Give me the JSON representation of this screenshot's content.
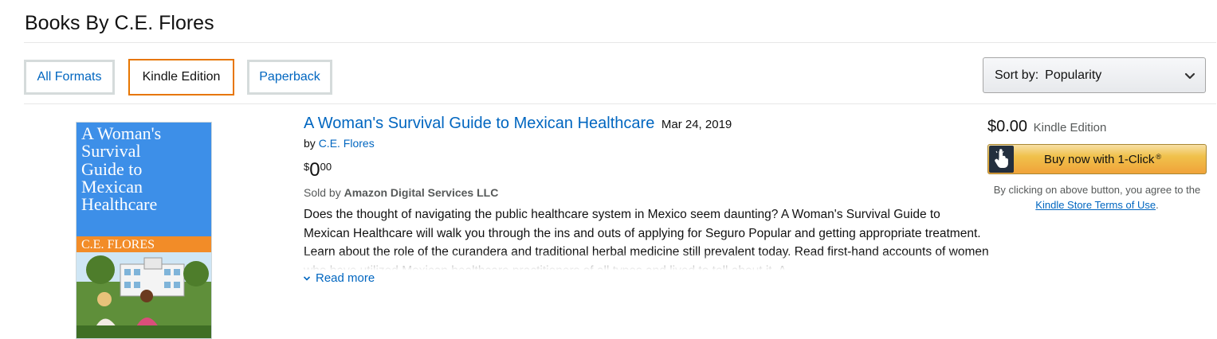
{
  "page": {
    "title": "Books By C.E. Flores"
  },
  "filters": {
    "formats": [
      {
        "label": "All Formats"
      },
      {
        "label": "Kindle Edition",
        "selected": true
      },
      {
        "label": "Paperback"
      }
    ]
  },
  "sort": {
    "label": "Sort by:",
    "value": "Popularity"
  },
  "book": {
    "cover": {
      "title_text": "A Woman's Survival Guide to Mexican Healthcare",
      "author_text": "C.E. FLORES",
      "colors": {
        "sky": "#3d8fe8",
        "band": "#f28c28"
      }
    },
    "title": "A Woman's Survival Guide to Mexican Healthcare",
    "date": "Mar 24, 2019",
    "by_label": "by",
    "author": "C.E. Flores",
    "price": {
      "symbol": "$",
      "whole": "0",
      "fraction": "00"
    },
    "sold_by_label": "Sold by",
    "seller": "Amazon Digital Services LLC",
    "description": "Does the thought of navigating the public healthcare system in Mexico seem daunting? A Woman's Survival Guide to Mexican Healthcare will walk you through the ins and outs of applying for Seguro Popular and getting appropriate treatment. Learn about the role of the curandera and traditional herbal medicine still prevalent today. Read first-hand accounts of women who have utilized Mexican healthcare practitioners of all types and lived to tell about it. A",
    "read_more": "Read more"
  },
  "purchase": {
    "price": "$0.00",
    "format": "Kindle Edition",
    "buy_label": "Buy now with 1-Click",
    "buy_mark": "®",
    "agree_prefix": "By clicking on above button, you agree to the",
    "terms_link": "Kindle Store Terms of Use",
    "agree_suffix": "."
  },
  "colors": {
    "link": "#0066c0",
    "selected_border": "#e77600",
    "buy_button": "#f0c14b"
  }
}
